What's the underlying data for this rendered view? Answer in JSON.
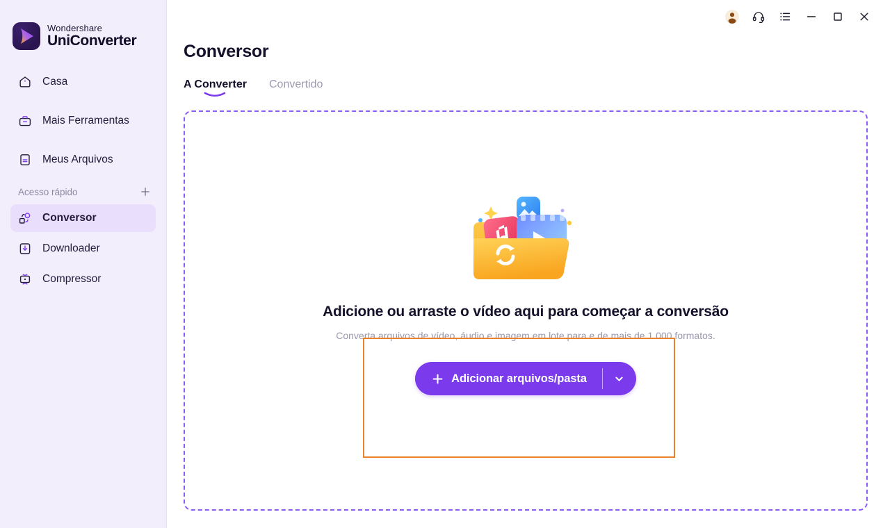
{
  "brand": {
    "line1": "Wondershare",
    "line2": "UniConverter",
    "logo_icon": "play-logo-icon"
  },
  "sidebar": {
    "items": [
      {
        "id": "casa",
        "label": "Casa",
        "icon": "home-icon",
        "active": false
      },
      {
        "id": "mais-ferramentas",
        "label": "Mais Ferramentas",
        "icon": "toolbox-icon",
        "active": false
      },
      {
        "id": "meus-arquivos",
        "label": "Meus Arquivos",
        "icon": "files-icon",
        "active": false
      }
    ],
    "quick_access": {
      "label": "Acesso rápido",
      "add_icon": "plus-icon",
      "items": [
        {
          "id": "conversor",
          "label": "Conversor",
          "icon": "converter-icon",
          "active": true
        },
        {
          "id": "downloader",
          "label": "Downloader",
          "icon": "download-icon",
          "active": false
        },
        {
          "id": "compressor",
          "label": "Compressor",
          "icon": "compress-icon",
          "active": false
        }
      ]
    }
  },
  "titlebar": {
    "buttons": [
      {
        "id": "account",
        "icon": "avatar-icon",
        "label": ""
      },
      {
        "id": "support",
        "icon": "headset-icon",
        "label": ""
      },
      {
        "id": "menu",
        "icon": "list-menu-icon",
        "label": ""
      },
      {
        "id": "minimize",
        "icon": "minimize-icon",
        "label": ""
      },
      {
        "id": "maximize",
        "icon": "maximize-icon",
        "label": ""
      },
      {
        "id": "close",
        "icon": "close-icon",
        "label": ""
      }
    ]
  },
  "header": {
    "title": "Conversor"
  },
  "tabs": [
    {
      "id": "a-converter",
      "label": "A Converter",
      "active": true
    },
    {
      "id": "convertido",
      "label": "Convertido",
      "active": false
    }
  ],
  "dropzone": {
    "illustration_icon": "folder-media-convert-illustration",
    "title": "Adicione ou arraste o vídeo aqui para começar a conversão",
    "subtitle": "Converta arquivos de vídeo, áudio e imagem em lote para e de mais de 1.000 formatos.",
    "add_button": {
      "label": "Adicionar arquivos/pasta",
      "plus_icon": "plus-icon",
      "caret_icon": "chevron-down-icon"
    }
  },
  "colors": {
    "accent": "#7c3aed",
    "sidebar_bg": "#f3eefc",
    "sidebar_active_bg": "#e9defb",
    "dashed_border": "#8b5cf6",
    "annotation": "#e8822c",
    "muted_text": "#9b98ac"
  },
  "annotation": {
    "name": "highlight-box",
    "color": "#e8822c"
  }
}
